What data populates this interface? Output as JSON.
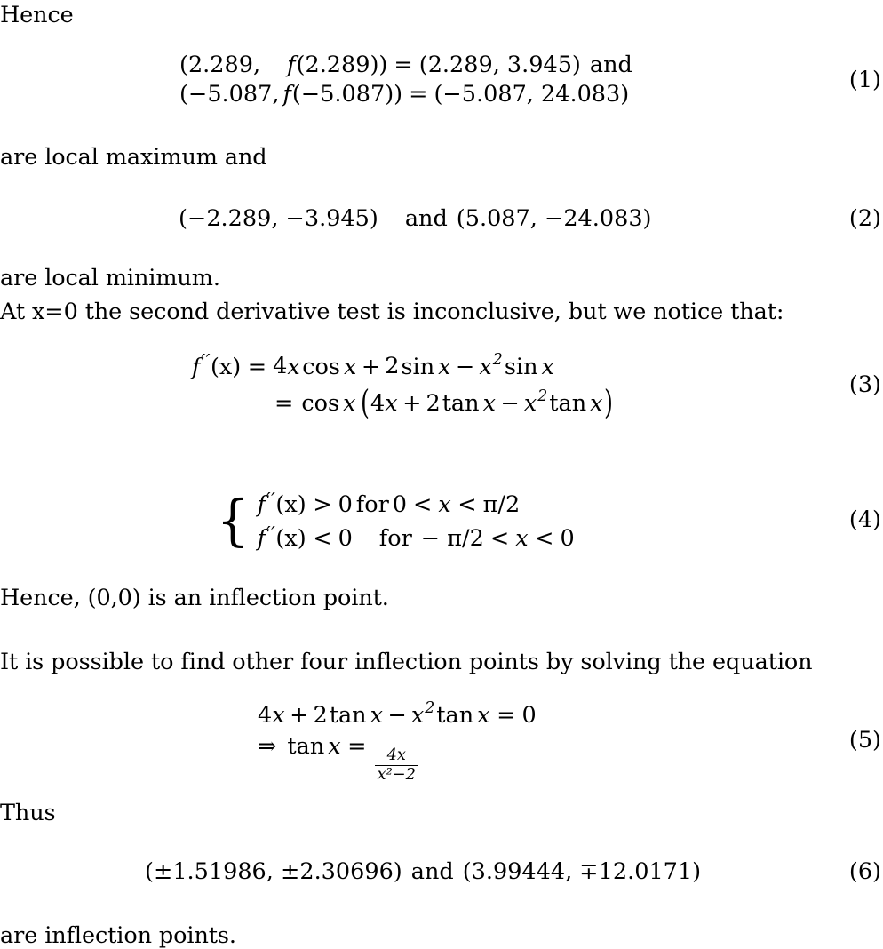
{
  "document": {
    "type": "mathematical-proof-excerpt",
    "topic": "Local extrema and inflection points of f(x) = x^2 sin x"
  },
  "blocks": {
    "hence_label": "Hence",
    "local_max_text": "are local maximum and",
    "local_min_text": "are local minimum.",
    "second_derivative_text": "At x=0 the second derivative test is inconclusive, but we notice that:",
    "inflection_origin_text_pre": "Hence, ",
    "inflection_origin_point": "(0,0)",
    "inflection_origin_text_post": " is an inflection point.",
    "other_inflection_text": "It is possible to find other four inflection points by solving the equation",
    "thus_label": "Thus",
    "are_inflection_text": "are inflection points."
  },
  "equations": {
    "eq1": {
      "number": "(1)",
      "line1": {
        "lhs_open": "(",
        "x_value": "2.289,",
        "fn_name": "f",
        "fn_arg": "(2.289)",
        "close": ")",
        "equals": "=",
        "rhs": "(2.289, 3.945)",
        "trailing_word": "and"
      },
      "line2": {
        "lhs_open": "(",
        "x_value": "−5.087,",
        "fn_name": "f",
        "fn_arg": "(−5.087)",
        "close": ")",
        "equals": "=",
        "rhs": "(−5.087, 24.083)"
      }
    },
    "eq2": {
      "number": "(2)",
      "point_a": "(−2.289, −3.945)",
      "conjunction": "and",
      "point_b": "(5.087, −24.083)"
    },
    "eq3": {
      "number": "(3)",
      "line1": {
        "fn": "f",
        "primes": "′′",
        "arg": "(x)",
        "equals": "=",
        "term1_coeff": "4",
        "term1_var": "x",
        "term1_fn": "cos",
        "term1_fnarg": "x",
        "plus": "+",
        "term2_coeff": "2",
        "term2_fn": "sin",
        "term2_fnarg": "x",
        "minus": "−",
        "term3_var": "x",
        "term3_pow": "2",
        "term3_fn": "sin",
        "term3_fnarg": "x"
      },
      "line2": {
        "equals": "=",
        "cos": "cos",
        "cos_arg": "x",
        "open": "(",
        "t1_coeff": "4",
        "t1_var": "x",
        "plus": "+",
        "t2_coeff": "2",
        "t2_fn": "tan",
        "t2_arg": "x",
        "minus": "−",
        "t3_var": "x",
        "t3_pow": "2",
        "t3_fn": "tan",
        "t3_arg": "x",
        "close": ")"
      }
    },
    "eq4": {
      "number": "(4)",
      "case1": {
        "fn": "f",
        "primes": "′′",
        "arg": "(x)",
        "rel": ">",
        "value": "0",
        "word": "for",
        "range_lo": "0",
        "lt1": "<",
        "var": "x",
        "lt2": "<",
        "range_hi": "π/2"
      },
      "case2": {
        "fn": "f",
        "primes": "′′",
        "arg": "(x)",
        "rel": "<",
        "value": "0",
        "word": "for",
        "range_lo": "− π/2",
        "lt1": "<",
        "var": "x",
        "lt2": "<",
        "range_hi": "0"
      }
    },
    "eq5": {
      "number": "(5)",
      "line1": {
        "t1_coeff": "4",
        "t1_var": "x",
        "plus": "+",
        "t2_coeff": "2",
        "t2_fn": "tan",
        "t2_arg": "x",
        "minus": "−",
        "t3_var": "x",
        "t3_pow": "2",
        "t3_fn": "tan",
        "t3_arg": "x",
        "equals": "=",
        "rhs": "0"
      },
      "line2": {
        "arrow": "⇒",
        "fn": "tan",
        "arg": "x",
        "equals": "=",
        "fraction_numerator": "4x",
        "fraction_denominator": "x²−2"
      }
    },
    "eq6": {
      "number": "(6)",
      "point_a": "(±1.51986, ±2.30696)",
      "conjunction": "and",
      "point_b": "(3.99444, ∓12.0171)"
    }
  }
}
